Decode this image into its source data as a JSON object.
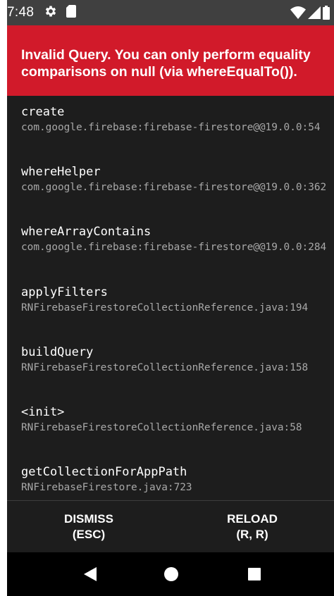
{
  "status_bar": {
    "time": "7:48",
    "icons": [
      "gear-icon",
      "sd-card-icon",
      "wifi-icon",
      "signal-icon",
      "battery-icon"
    ]
  },
  "error": {
    "message": "Invalid Query. You can only perform equality comparisons on null (via whereEqualTo())."
  },
  "stack_frames": [
    {
      "method": "create",
      "file": "com.google.firebase:firebase-firestore@@19.0.0:54"
    },
    {
      "method": "whereHelper",
      "file": "com.google.firebase:firebase-firestore@@19.0.0:362"
    },
    {
      "method": "whereArrayContains",
      "file": "com.google.firebase:firebase-firestore@@19.0.0:284"
    },
    {
      "method": "applyFilters",
      "file": "RNFirebaseFirestoreCollectionReference.java:194"
    },
    {
      "method": "buildQuery",
      "file": "RNFirebaseFirestoreCollectionReference.java:158"
    },
    {
      "method": "<init>",
      "file": "RNFirebaseFirestoreCollectionReference.java:58"
    },
    {
      "method": "getCollectionForAppPath",
      "file": "RNFirebaseFirestore.java:723"
    }
  ],
  "actions": {
    "dismiss": {
      "label": "DISMISS",
      "shortcut": "(ESC)"
    },
    "reload": {
      "label": "RELOAD",
      "shortcut": "(R, R)"
    }
  },
  "nav_bar": {
    "buttons": [
      "back-icon",
      "home-icon",
      "recents-icon"
    ]
  },
  "colors": {
    "error_red": "#d11a2a",
    "background": "#1d1d1d",
    "status_bar": "#404040",
    "file_text": "#a8a8a8"
  }
}
